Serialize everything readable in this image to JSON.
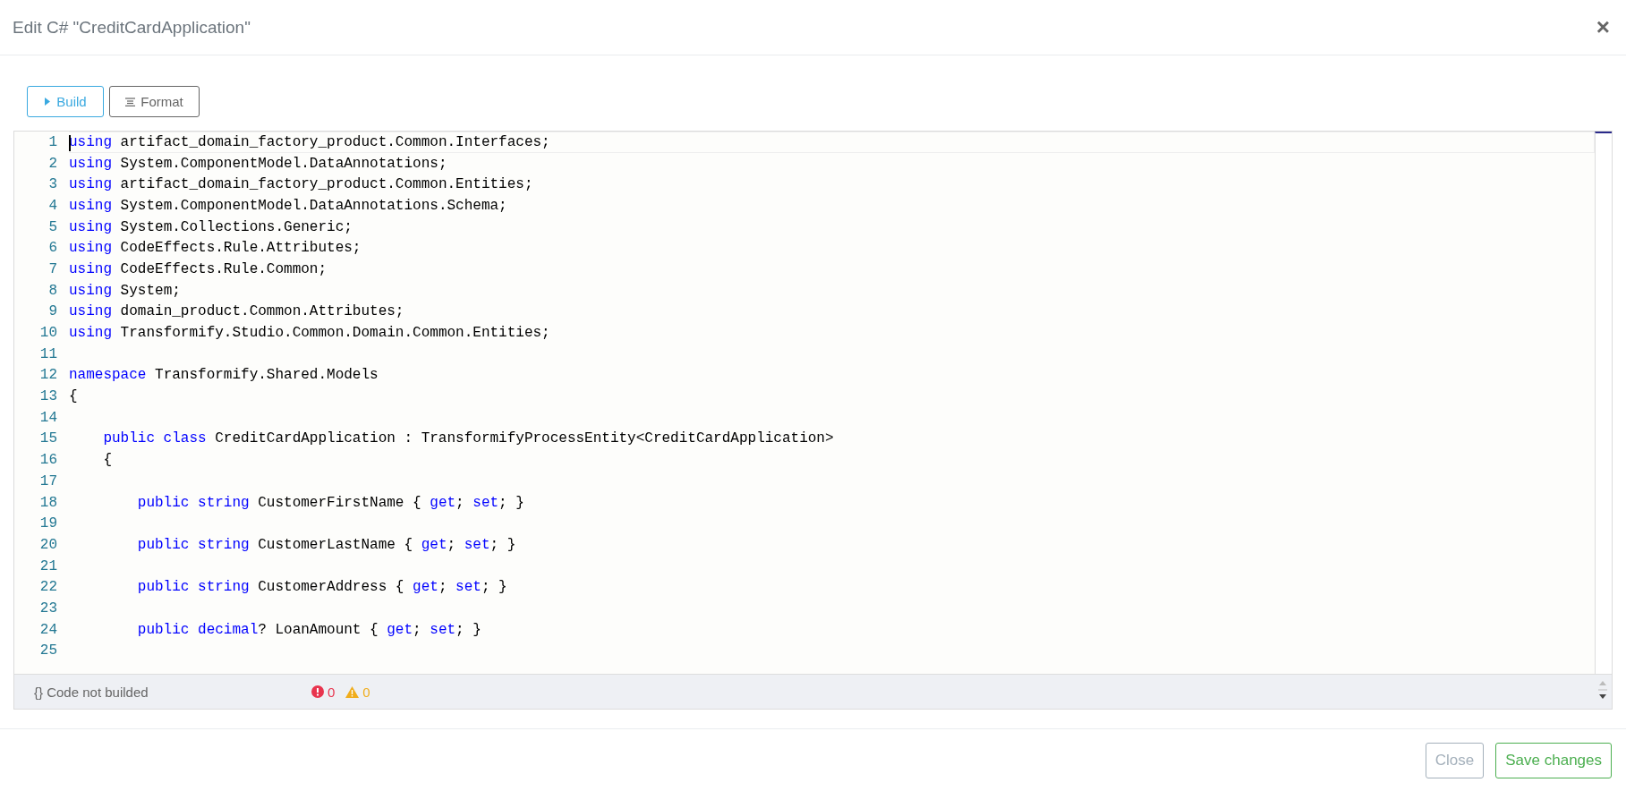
{
  "dialog": {
    "title": "Edit C# \"CreditCardApplication\"",
    "close_glyph": "×"
  },
  "toolbar": {
    "buttons": [
      {
        "kind": "build",
        "label": "Build"
      },
      {
        "kind": "format",
        "label": "Format"
      }
    ]
  },
  "editor": {
    "lines": [
      {
        "number": "1",
        "current": true,
        "tokens": [
          {
            "kind": "kw",
            "text": "using"
          },
          {
            "kind": "text",
            "text": " artifact_domain_factory_product.Common.Interfaces;"
          }
        ]
      },
      {
        "number": "2",
        "current": false,
        "tokens": [
          {
            "kind": "kw",
            "text": "using"
          },
          {
            "kind": "text",
            "text": " System.ComponentModel.DataAnnotations;"
          }
        ]
      },
      {
        "number": "3",
        "current": false,
        "tokens": [
          {
            "kind": "kw",
            "text": "using"
          },
          {
            "kind": "text",
            "text": " artifact_domain_factory_product.Common.Entities;"
          }
        ]
      },
      {
        "number": "4",
        "current": false,
        "tokens": [
          {
            "kind": "kw",
            "text": "using"
          },
          {
            "kind": "text",
            "text": " System.ComponentModel.DataAnnotations.Schema;"
          }
        ]
      },
      {
        "number": "5",
        "current": false,
        "tokens": [
          {
            "kind": "kw",
            "text": "using"
          },
          {
            "kind": "text",
            "text": " System.Collections.Generic;"
          }
        ]
      },
      {
        "number": "6",
        "current": false,
        "tokens": [
          {
            "kind": "kw",
            "text": "using"
          },
          {
            "kind": "text",
            "text": " CodeEffects.Rule.Attributes;"
          }
        ]
      },
      {
        "number": "7",
        "current": false,
        "tokens": [
          {
            "kind": "kw",
            "text": "using"
          },
          {
            "kind": "text",
            "text": " CodeEffects.Rule.Common;"
          }
        ]
      },
      {
        "number": "8",
        "current": false,
        "tokens": [
          {
            "kind": "kw",
            "text": "using"
          },
          {
            "kind": "text",
            "text": " System;"
          }
        ]
      },
      {
        "number": "9",
        "current": false,
        "tokens": [
          {
            "kind": "kw",
            "text": "using"
          },
          {
            "kind": "text",
            "text": " domain_product.Common.Attributes;"
          }
        ]
      },
      {
        "number": "10",
        "current": false,
        "tokens": [
          {
            "kind": "kw",
            "text": "using"
          },
          {
            "kind": "text",
            "text": " Transformify.Studio.Common.Domain.Common.Entities;"
          }
        ]
      },
      {
        "number": "11",
        "current": false
      },
      {
        "number": "12",
        "current": false,
        "tokens": [
          {
            "kind": "kw",
            "text": "namespace"
          },
          {
            "kind": "text",
            "text": " Transformify.Shared.Models"
          }
        ]
      },
      {
        "number": "13",
        "current": false,
        "tokens": [
          {
            "kind": "text",
            "text": "{"
          }
        ]
      },
      {
        "number": "14",
        "current": false
      },
      {
        "number": "15",
        "current": false,
        "tokens": [
          {
            "kind": "kw",
            "text": "    public class"
          },
          {
            "kind": "text",
            "text": " CreditCardApplication : TransformifyProcessEntity<CreditCardApplication>"
          }
        ]
      },
      {
        "number": "16",
        "current": false,
        "tokens": [
          {
            "kind": "text",
            "text": "    {"
          }
        ]
      },
      {
        "number": "17",
        "current": false
      },
      {
        "number": "18",
        "current": false,
        "tokens": [
          {
            "kind": "kw",
            "text": "        public string"
          },
          {
            "kind": "text",
            "text": " CustomerFirstName { "
          },
          {
            "kind": "kw",
            "text": "get"
          },
          {
            "kind": "text",
            "text": "; "
          },
          {
            "kind": "kw",
            "text": "set"
          },
          {
            "kind": "text",
            "text": "; }"
          }
        ]
      },
      {
        "number": "19",
        "current": false
      },
      {
        "number": "20",
        "current": false,
        "tokens": [
          {
            "kind": "kw",
            "text": "        public string"
          },
          {
            "kind": "text",
            "text": " CustomerLastName { "
          },
          {
            "kind": "kw",
            "text": "get"
          },
          {
            "kind": "text",
            "text": "; "
          },
          {
            "kind": "kw",
            "text": "set"
          },
          {
            "kind": "text",
            "text": "; }"
          }
        ]
      },
      {
        "number": "21",
        "current": false
      },
      {
        "number": "22",
        "current": false,
        "tokens": [
          {
            "kind": "kw",
            "text": "        public string"
          },
          {
            "kind": "text",
            "text": " CustomerAddress { "
          },
          {
            "kind": "kw",
            "text": "get"
          },
          {
            "kind": "text",
            "text": "; "
          },
          {
            "kind": "kw",
            "text": "set"
          },
          {
            "kind": "text",
            "text": "; }"
          }
        ]
      },
      {
        "number": "23",
        "current": false
      },
      {
        "number": "24",
        "current": false,
        "tokens": [
          {
            "kind": "kw",
            "text": "        public decimal"
          },
          {
            "kind": "text",
            "text": "? LoanAmount { "
          },
          {
            "kind": "kw",
            "text": "get"
          },
          {
            "kind": "text",
            "text": "; "
          },
          {
            "kind": "kw",
            "text": "set"
          },
          {
            "kind": "text",
            "text": "; }"
          }
        ]
      },
      {
        "number": "25",
        "current": false
      }
    ]
  },
  "status_bar": {
    "braces": "{}",
    "status": "Code not builded",
    "errors": "0",
    "warnings": "0"
  },
  "footer": {
    "buttons": [
      {
        "kind": "close",
        "label": "Close"
      },
      {
        "kind": "save",
        "label": "Save changes"
      }
    ]
  }
}
